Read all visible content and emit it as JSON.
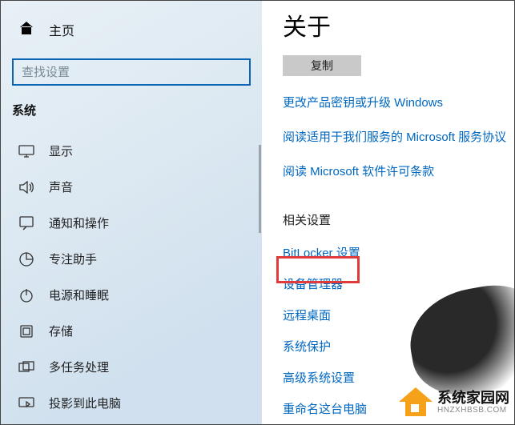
{
  "sidebar": {
    "home": "主页",
    "search_placeholder": "查找设置",
    "section": "系统",
    "items": [
      {
        "icon": "display",
        "label": "显示"
      },
      {
        "icon": "sound",
        "label": "声音"
      },
      {
        "icon": "notify",
        "label": "通知和操作"
      },
      {
        "icon": "focus",
        "label": "专注助手"
      },
      {
        "icon": "power",
        "label": "电源和睡眠"
      },
      {
        "icon": "storage",
        "label": "存储"
      },
      {
        "icon": "multitask",
        "label": "多任务处理"
      },
      {
        "icon": "project",
        "label": "投影到此电脑"
      }
    ]
  },
  "content": {
    "title": "关于",
    "copy_button": "复制",
    "links": [
      "更改产品密钥或升级 Windows",
      "阅读适用于我们服务的 Microsoft 服务协议",
      "阅读 Microsoft 软件许可条款"
    ],
    "related_heading": "相关设置",
    "related_links": [
      "BitLocker 设置",
      "设备管理器",
      "远程桌面",
      "系统保护",
      "高级系统设置",
      "重命名这台电脑"
    ]
  },
  "watermark": {
    "line1": "系统家园网",
    "line2": "HNZXHBSB.COM"
  },
  "highlighted_related_index": 1
}
